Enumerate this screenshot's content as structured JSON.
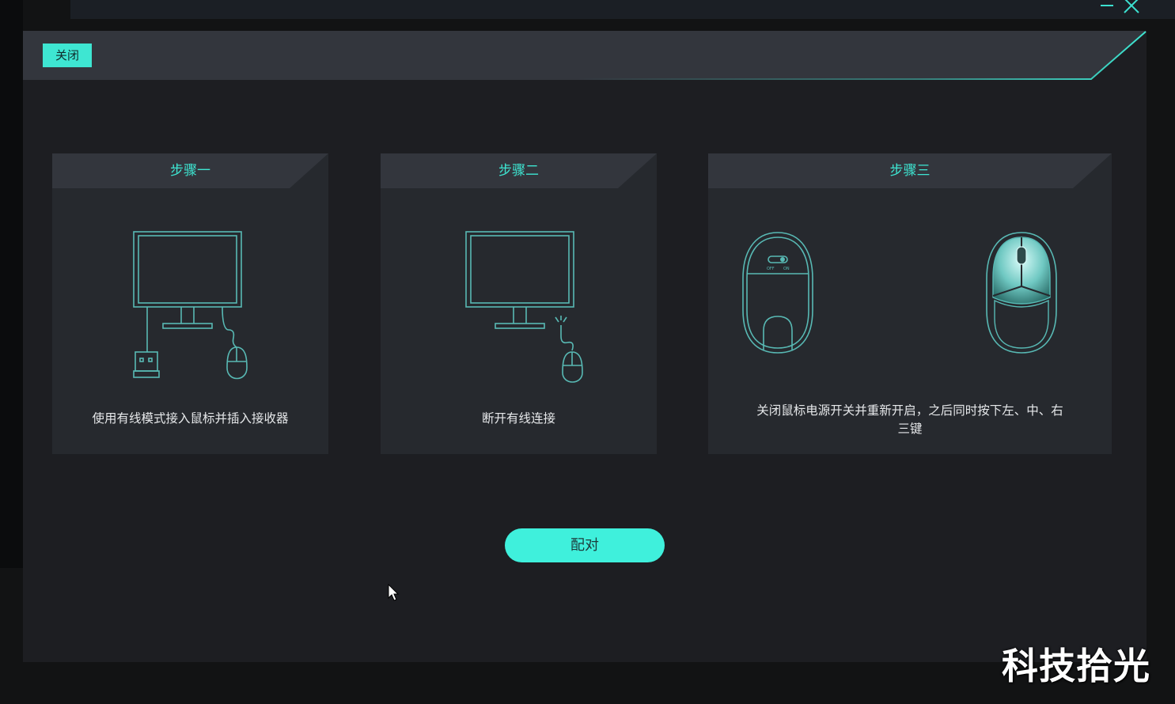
{
  "dialog": {
    "close_label": "关闭",
    "pair_label": "配对",
    "accent_color": "#3ee6d2"
  },
  "steps": [
    {
      "title": "步骤一",
      "description": "使用有线模式接入鼠标并插入接收器",
      "illustration": "monitor-receiver-wired-mouse"
    },
    {
      "title": "步骤二",
      "description": "断开有线连接",
      "illustration": "monitor-disconnected-mouse"
    },
    {
      "title": "步骤三",
      "description_line1": "关闭鼠标电源开关并重新开启，之后同时按下左、中、右",
      "description_line2": "三键",
      "switch_off": "OFF",
      "switch_on": "ON",
      "illustration": "mouse-bottom-switch-and-top-buttons"
    }
  ],
  "watermark": "科技拾光",
  "icons": [
    "minimize-icon",
    "close-window-icon",
    "cursor-arrow-icon"
  ]
}
